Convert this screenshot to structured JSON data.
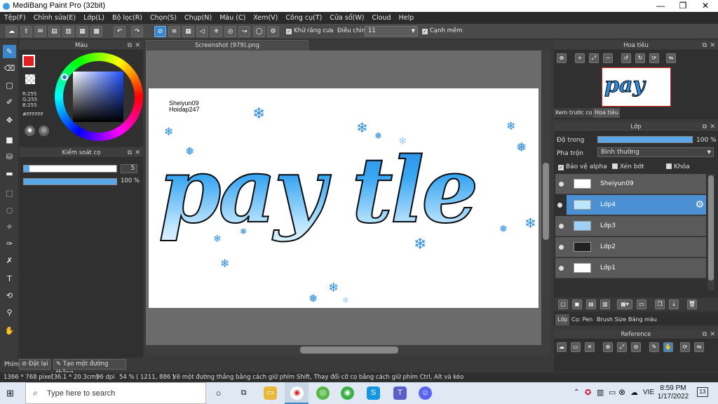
{
  "window": {
    "title": "MediBang Paint Pro (32bit)",
    "minimize": "—",
    "maximize": "❐",
    "close": "✕"
  },
  "menu": [
    "Tệp(F)",
    "Chỉnh sửa(E)",
    "Lớp(L)",
    "Bộ lọc(R)",
    "Chọn(S)",
    "Chụp(N)",
    "Màu (C)",
    "Xem(V)",
    "Công cụ(T)",
    "Cửa sổ(W)",
    "Cloud",
    "Help"
  ],
  "toolbar": {
    "antialias": "Khử răng cưa",
    "correction": "Điều chỉnh",
    "correction_value": "11",
    "edge": "Cạnh mềm"
  },
  "color_panel": {
    "title": "Màu",
    "r": "R:255",
    "g": "G:255",
    "b": "B:255",
    "hex": "#FFFFFF"
  },
  "brush_panel": {
    "title": "Kiểm soát cọ",
    "size": "5",
    "opacity": "100 %"
  },
  "document": {
    "tab": "Screenshot (979).png",
    "label1": "Sheiyun09",
    "label2": "Hoidap247",
    "art_text": "pay tle"
  },
  "navigator": {
    "title": "Hoa tiêu",
    "tab_preview": "Xem trước cọ",
    "tab_nav": "Hoa tiêu"
  },
  "layers": {
    "title": "Lớp",
    "opacity_label": "Độ trong",
    "opacity_value": "100 %",
    "blend_label": "Pha trộn",
    "blend_value": "Bình thường",
    "protect_alpha": "Bảo vệ alpha",
    "clipping": "Xén bớt",
    "lock": "Khóa",
    "items": [
      {
        "name": "Sheiyun09",
        "selected": false
      },
      {
        "name": "Lớp4",
        "selected": true
      },
      {
        "name": "Lớp3",
        "selected": false
      },
      {
        "name": "Lớp2",
        "selected": false
      },
      {
        "name": "Lớp1",
        "selected": false
      }
    ],
    "tabs": [
      "Lớp",
      "Cọ: Pen",
      "Brush Size",
      "Bảng màu"
    ]
  },
  "reference": {
    "title": "Reference"
  },
  "bottom_bar": {
    "label": "Phím",
    "reset": "Đặt lại",
    "straight": "Tạo một đường thẳng"
  },
  "status": {
    "dims": "1366 * 768 pixel",
    "cm": "(36.1 * 20.3cm)",
    "dpi": "96 dpi",
    "zoom": "54 %",
    "coords": "( 1211, 886 )",
    "hint": "Vẽ một đường thẳng bằng cách giữ phím Shift, Thay đổi cỡ cọ bằng cách giữ phím Ctrl, Alt và kéo"
  },
  "taskbar": {
    "search": "Type here to search",
    "lang": "VIE",
    "time": "8:59 PM",
    "date": "1/17/2022",
    "notif": "13"
  },
  "colors": {
    "accent": "#3a86c8",
    "art_blue": "#2e8de0",
    "art_light": "#bfe6ff"
  }
}
